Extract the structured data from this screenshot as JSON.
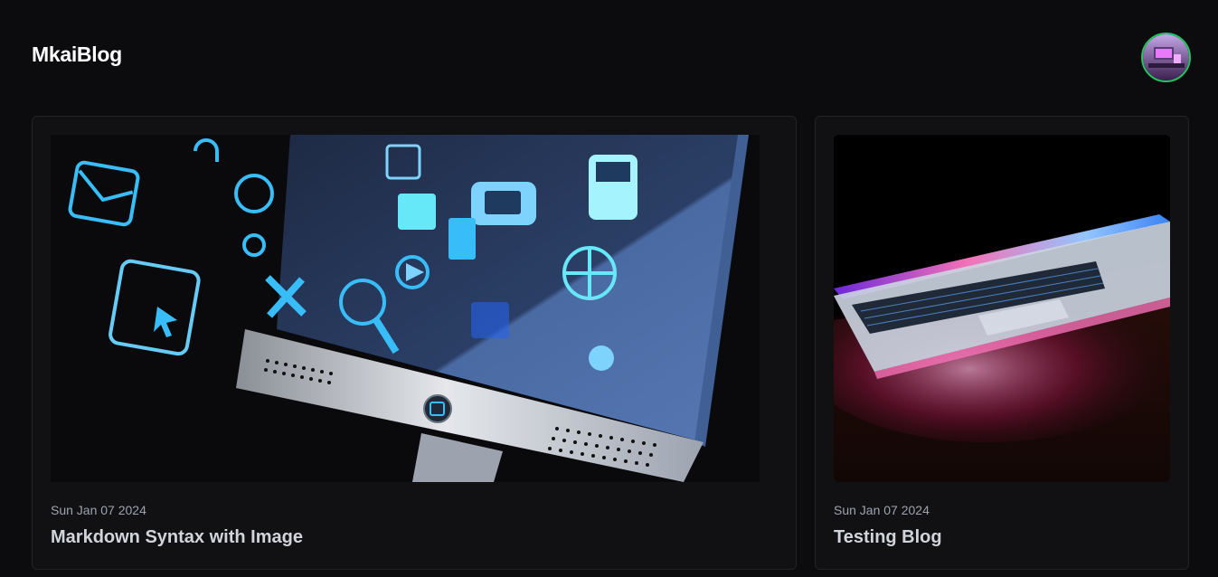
{
  "header": {
    "brand": "MkaiBlog",
    "avatar_icon": "user-avatar-icon"
  },
  "posts": [
    {
      "date": "Sun Jan 07 2024",
      "title": "Markdown Syntax with Image",
      "image_icon": "computer-monitor-apps-icon"
    },
    {
      "date": "Sun Jan 07 2024",
      "title": "Testing Blog",
      "image_icon": "laptop-icon"
    }
  ],
  "colors": {
    "background": "#0c0c0e",
    "card": "#111113",
    "avatar_ring": "#22c55e",
    "icon_blue": "#38bdf8"
  }
}
